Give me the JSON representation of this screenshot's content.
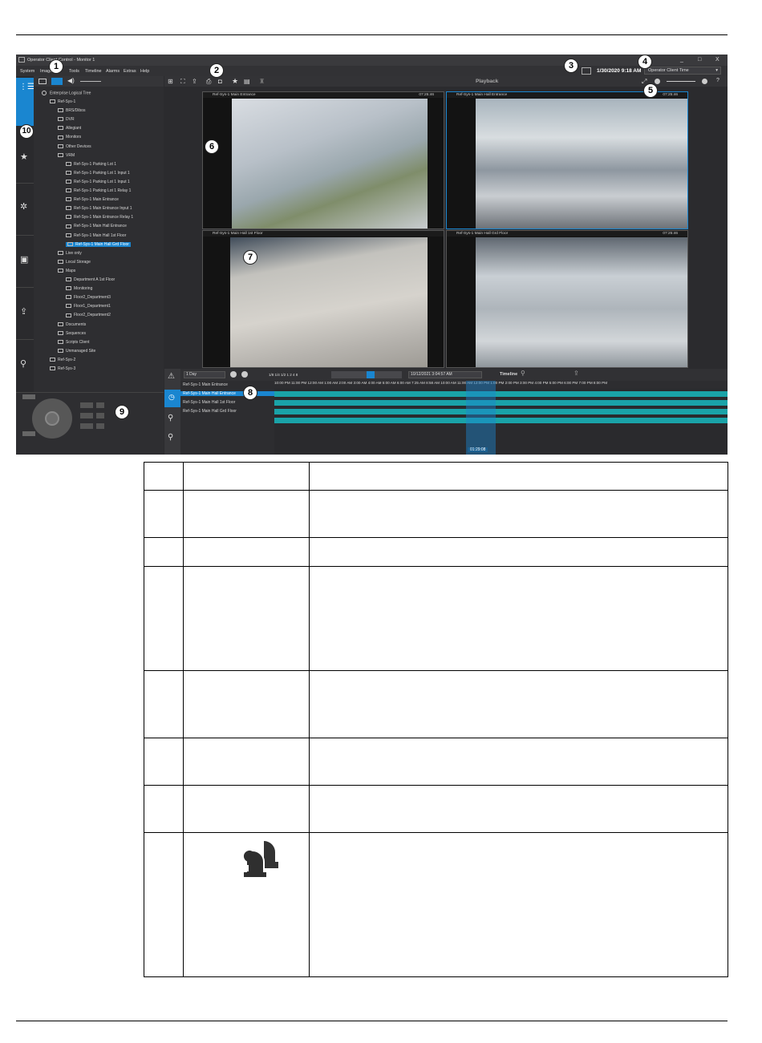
{
  "app": {
    "window_title": "Operator Client Control - Monitor 1",
    "menu": [
      "System",
      "Image",
      "Tools",
      "Timeline",
      "Alarms",
      "Extras",
      "Help"
    ],
    "clock": "1/30/2020 9:18 AM",
    "time_mode": "Operator Client Time",
    "panel_title": "Playback",
    "window_controls": [
      "_",
      "□",
      "X"
    ]
  },
  "tree": {
    "root": "Enterprise Logical Tree",
    "nodes": [
      {
        "label": "Ref-Sys-1",
        "level": 1
      },
      {
        "label": "BRS/Dibos",
        "level": 2
      },
      {
        "label": "DVR",
        "level": 2
      },
      {
        "label": "Allegiant",
        "level": 2
      },
      {
        "label": "Monitors",
        "level": 2
      },
      {
        "label": "Other Devices",
        "level": 2
      },
      {
        "label": "VRM",
        "level": 2
      },
      {
        "label": "Ref-Sys-1 Parking Lot 1",
        "level": 3
      },
      {
        "label": "Ref-Sys-1 Parking Lot 1 Input 1",
        "level": 3
      },
      {
        "label": "Ref-Sys-1 Parking Lot 1 Input 1",
        "level": 3
      },
      {
        "label": "Ref-Sys-1 Parking Lot 1 Relay 1",
        "level": 3
      },
      {
        "label": "Ref-Sys-1 Main Entrance",
        "level": 3
      },
      {
        "label": "Ref-Sys-1 Main Entrance Input 1",
        "level": 3
      },
      {
        "label": "Ref-Sys-1 Main Entrance Relay 1",
        "level": 3
      },
      {
        "label": "Ref-Sys-1 Main Hall Entrance",
        "level": 3
      },
      {
        "label": "Ref-Sys-1 Main Hall 1st Floor",
        "level": 3
      },
      {
        "label": "Ref-Sys-1 Main Hall Grd Floor",
        "level": 3,
        "selected": true
      },
      {
        "label": "Live only",
        "level": 2
      },
      {
        "label": "Local Storage",
        "level": 2
      },
      {
        "label": "Maps",
        "level": 2
      },
      {
        "label": "Department A 1st Floor",
        "level": 3
      },
      {
        "label": "Monitoring",
        "level": 3
      },
      {
        "label": "Floor2_Department3",
        "level": 3
      },
      {
        "label": "Floor1_Department1",
        "level": 3
      },
      {
        "label": "Floor2_Department2",
        "level": 3
      },
      {
        "label": "Documents",
        "level": 2
      },
      {
        "label": "Sequences",
        "level": 2
      },
      {
        "label": "Scripts Client",
        "level": 2
      },
      {
        "label": "Unmanaged Site",
        "level": 2
      },
      {
        "label": "Ref-Sys-2",
        "level": 1
      },
      {
        "label": "Ref-Sys-3",
        "level": 1
      }
    ]
  },
  "panes": [
    {
      "title": "Ref-Sys-1 Main Entrance",
      "time": "07:25:46"
    },
    {
      "title": "Ref-Sys-1 Main Hall Entrance",
      "time": "07:25:46"
    },
    {
      "title": "Ref-Sys-1 Main Hall 1st Floor",
      "time": ""
    },
    {
      "title": "Ref-Sys-1 Main Hall Grd Floor",
      "time": "07:25:46"
    }
  ],
  "timeline": {
    "range": "1 Day",
    "speeds": "1/8 1/4 1/2 1 2 4 8",
    "datetime": "10/12/2021 3:04:57 AM",
    "label": "Timeline",
    "tracks": [
      "Ref-Sys-1 Main Entrance",
      "Ref-Sys-1 Main Hall Entrance",
      "Ref-Sys-1 Main Hall 1st Floor",
      "Ref-Sys-1 Main Hall Grd Floor"
    ],
    "ticks": "10:00 PM  11:00 PM  12:00 AM  1:00 AM  2:00 AM  3:00 AM  4:00 AM  5:00 AM  6:00 AM  7:25 AM  8:58 AM  10:00 AM  11:00 AM  12:00 PM  1:00 PM  2:00 PM  3:00 PM  4:00 PM  5:00 PM  6:00 PM  7:00 PM  8:00 PM",
    "readout": "01:29:08"
  },
  "callouts": [
    "1",
    "2",
    "3",
    "4",
    "5",
    "6",
    "7",
    "8",
    "9",
    "10"
  ]
}
